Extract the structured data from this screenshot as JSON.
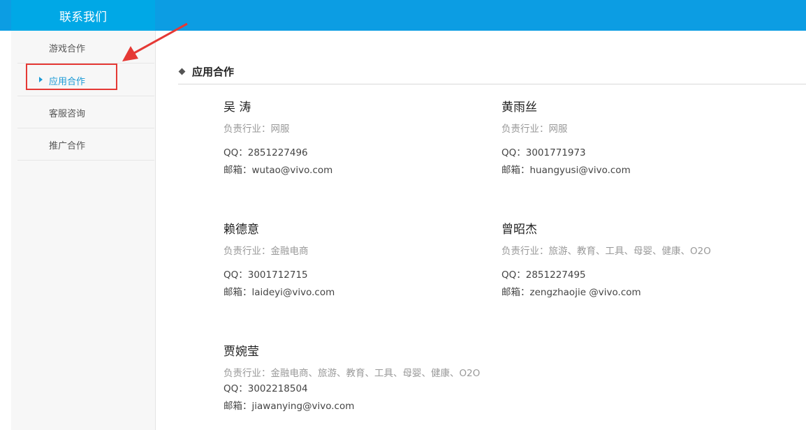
{
  "header": {
    "title": "联系我们"
  },
  "sidebar": {
    "items": [
      {
        "label": "游戏合作"
      },
      {
        "label": "应用合作"
      },
      {
        "label": "客服咨询"
      },
      {
        "label": "推广合作"
      }
    ],
    "active_index": 1
  },
  "section": {
    "title": "应用合作"
  },
  "contacts": [
    {
      "name": "吴 涛",
      "industry": "负责行业：网服",
      "qq": "QQ：2851227496",
      "email": "邮箱：wutao@vivo.com"
    },
    {
      "name": "黄雨丝",
      "industry": "负责行业：网服",
      "qq": "QQ：3001771973",
      "email": "邮箱：huangyusi@vivo.com"
    },
    {
      "name": "赖德意",
      "industry": "负责行业：金融电商",
      "qq": "QQ：3001712715",
      "email": "邮箱：laideyi@vivo.com"
    },
    {
      "name": "曾昭杰",
      "industry": "负责行业：旅游、教育、工具、母婴、健康、O2O",
      "qq": "QQ：2851227495",
      "email": "邮箱：zengzhaojie @vivo.com"
    },
    {
      "name": "贾婉莹",
      "industry": "负责行业：金融电商、旅游、教育、工具、母婴、健康、O2O",
      "qq": "QQ：3002218504",
      "email": "邮箱：jiawanying@vivo.com"
    }
  ],
  "colors": {
    "header_bg": "#0c9de3",
    "accent": "#1a9ad6",
    "annotation": "#e53935"
  }
}
